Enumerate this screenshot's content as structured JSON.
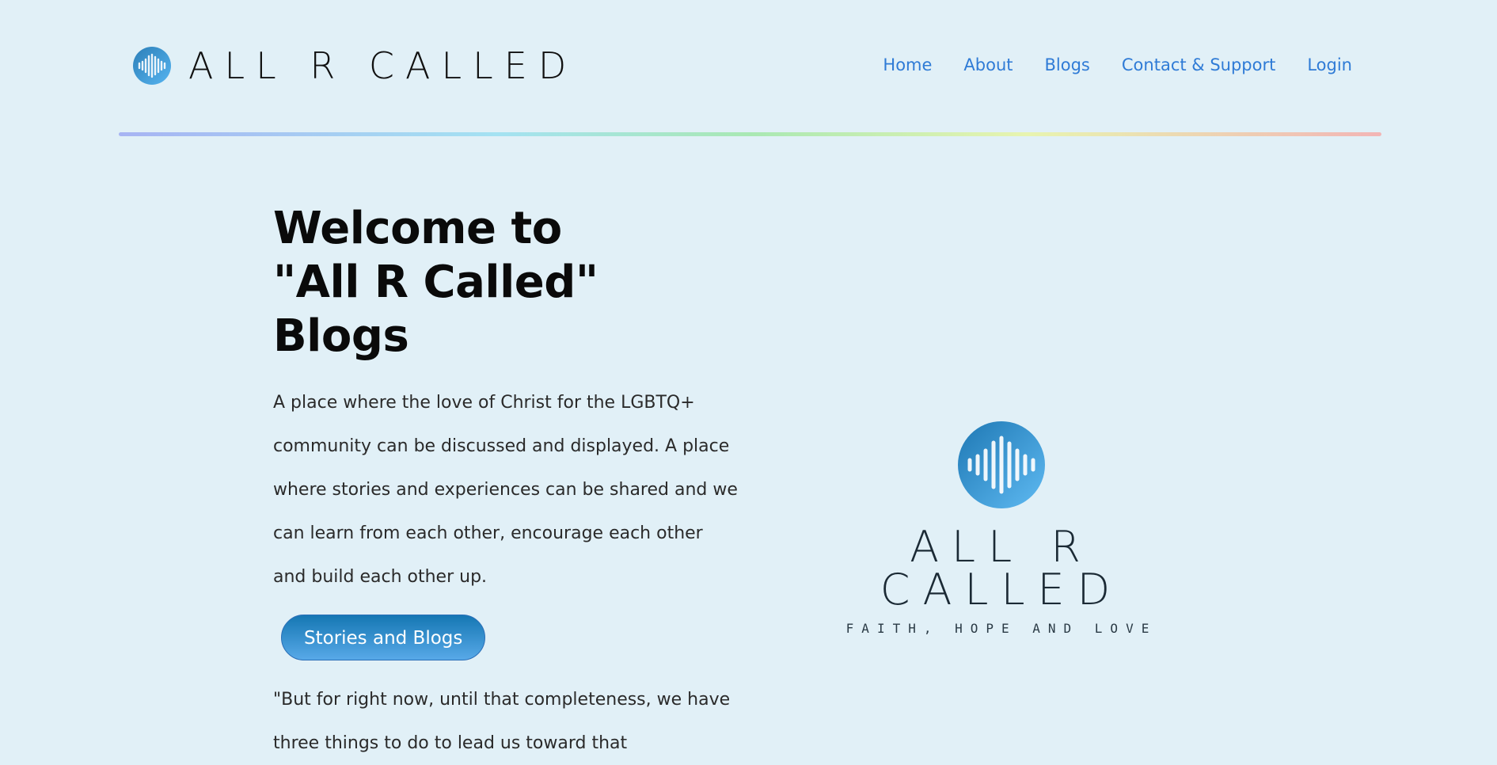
{
  "brand": {
    "name": "ALL R CALLED",
    "icon": "soundwave-icon"
  },
  "nav": {
    "items": [
      {
        "label": "Home"
      },
      {
        "label": "About"
      },
      {
        "label": "Blogs"
      },
      {
        "label": "Contact & Support"
      },
      {
        "label": "Login"
      }
    ]
  },
  "hero": {
    "title_line1": "Welcome to",
    "title_line2": "\"All R Called\" Blogs",
    "description": "A place where the love of Christ for the LGBTQ+ community can be discussed and displayed. A place where stories and experiences can be shared and we can learn from each other, encourage each other and build each other up.",
    "cta_label": "Stories and Blogs",
    "quote": "\"But for right now, until that completeness, we have three things to do to lead us toward that"
  },
  "logo": {
    "name": "ALL R CALLED",
    "tagline": "FAITH, HOPE AND LOVE",
    "icon": "soundwave-icon"
  },
  "colors": {
    "background": "#e1f0f7",
    "nav_link": "#2f7bd6",
    "button_top": "#1577b3",
    "button_bottom": "#58a9e8"
  }
}
